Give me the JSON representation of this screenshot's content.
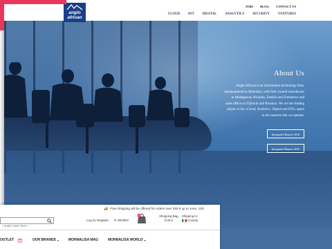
{
  "anglo": {
    "logo_line1": "anglo",
    "logo_line2": "african",
    "top_links": [
      "JOBS",
      "BLOG",
      "CONTACT US"
    ],
    "nav": [
      "CLOUD",
      "IOT",
      "DIGITAL",
      "ANALYTICS",
      "SECURITY",
      "VENTURES"
    ],
    "about_title": "About Us",
    "about_text": "Anglo African is an information technology firm, headquartered in Mauritius, with fully owned subsidiaries in Madagascar, Rwanda, Zambia and Zimbabwe and sales offices in Djibouti and Reunion. We are the leading player in the «Cloud, Analytics, Digital and IOT» space in the markets that we operate.",
    "report_2016": "Integrated Report 2016",
    "report_2015": "Integrated Report 2015"
  },
  "monnalisa": {
    "shipping_notice": "Free Shipping will be offered for orders over 250 € up to June, 11th",
    "search_placeholder": "r entire store here...",
    "login": "Log in/ Register",
    "wishlist": "Wishlist",
    "bag_count": "0",
    "bag_label": "Shopping Bag",
    "bag_amount": "0,00 €",
    "ship_label": "Shipping to:",
    "ship_country": "Country",
    "nav": [
      {
        "label": "OUTLET",
        "caret": false
      },
      {
        "label": "OUR BRANDS",
        "caret": true
      },
      {
        "label": "MONNALISA MAG",
        "caret": false
      },
      {
        "label": "MONNALISA WORLD",
        "caret": true
      }
    ]
  },
  "colors": {
    "brand_red": "#e9375c",
    "logo_blue": "#1a3f86",
    "heart_red": "#d62a3d"
  }
}
